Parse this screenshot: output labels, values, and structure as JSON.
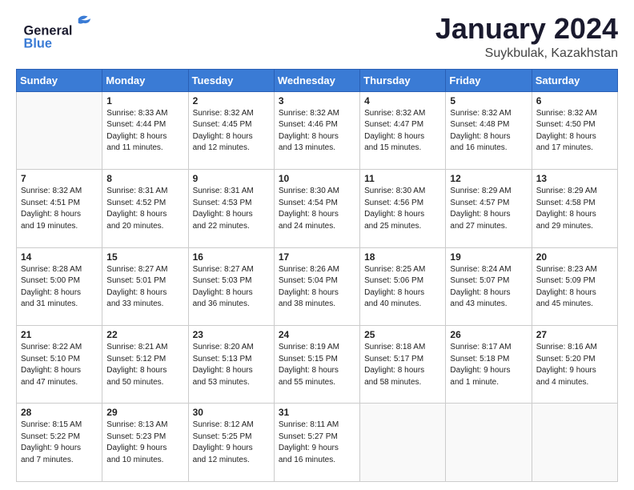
{
  "header": {
    "logo_line1": "General",
    "logo_line2": "Blue",
    "month": "January 2024",
    "location": "Suykbulak, Kazakhstan"
  },
  "days_of_week": [
    "Sunday",
    "Monday",
    "Tuesday",
    "Wednesday",
    "Thursday",
    "Friday",
    "Saturday"
  ],
  "weeks": [
    [
      {
        "day": "",
        "info": ""
      },
      {
        "day": "1",
        "info": "Sunrise: 8:33 AM\nSunset: 4:44 PM\nDaylight: 8 hours\nand 11 minutes."
      },
      {
        "day": "2",
        "info": "Sunrise: 8:32 AM\nSunset: 4:45 PM\nDaylight: 8 hours\nand 12 minutes."
      },
      {
        "day": "3",
        "info": "Sunrise: 8:32 AM\nSunset: 4:46 PM\nDaylight: 8 hours\nand 13 minutes."
      },
      {
        "day": "4",
        "info": "Sunrise: 8:32 AM\nSunset: 4:47 PM\nDaylight: 8 hours\nand 15 minutes."
      },
      {
        "day": "5",
        "info": "Sunrise: 8:32 AM\nSunset: 4:48 PM\nDaylight: 8 hours\nand 16 minutes."
      },
      {
        "day": "6",
        "info": "Sunrise: 8:32 AM\nSunset: 4:50 PM\nDaylight: 8 hours\nand 17 minutes."
      }
    ],
    [
      {
        "day": "7",
        "info": ""
      },
      {
        "day": "8",
        "info": "Sunrise: 8:31 AM\nSunset: 4:52 PM\nDaylight: 8 hours\nand 20 minutes."
      },
      {
        "day": "9",
        "info": "Sunrise: 8:31 AM\nSunset: 4:53 PM\nDaylight: 8 hours\nand 22 minutes."
      },
      {
        "day": "10",
        "info": "Sunrise: 8:30 AM\nSunset: 4:54 PM\nDaylight: 8 hours\nand 24 minutes."
      },
      {
        "day": "11",
        "info": "Sunrise: 8:30 AM\nSunset: 4:56 PM\nDaylight: 8 hours\nand 25 minutes."
      },
      {
        "day": "12",
        "info": "Sunrise: 8:29 AM\nSunset: 4:57 PM\nDaylight: 8 hours\nand 27 minutes."
      },
      {
        "day": "13",
        "info": "Sunrise: 8:29 AM\nSunset: 4:58 PM\nDaylight: 8 hours\nand 29 minutes."
      }
    ],
    [
      {
        "day": "14",
        "info": ""
      },
      {
        "day": "15",
        "info": "Sunrise: 8:27 AM\nSunset: 5:01 PM\nDaylight: 8 hours\nand 33 minutes."
      },
      {
        "day": "16",
        "info": "Sunrise: 8:27 AM\nSunset: 5:03 PM\nDaylight: 8 hours\nand 36 minutes."
      },
      {
        "day": "17",
        "info": "Sunrise: 8:26 AM\nSunset: 5:04 PM\nDaylight: 8 hours\nand 38 minutes."
      },
      {
        "day": "18",
        "info": "Sunrise: 8:25 AM\nSunset: 5:06 PM\nDaylight: 8 hours\nand 40 minutes."
      },
      {
        "day": "19",
        "info": "Sunrise: 8:24 AM\nSunset: 5:07 PM\nDaylight: 8 hours\nand 43 minutes."
      },
      {
        "day": "20",
        "info": "Sunrise: 8:23 AM\nSunset: 5:09 PM\nDaylight: 8 hours\nand 45 minutes."
      }
    ],
    [
      {
        "day": "21",
        "info": ""
      },
      {
        "day": "22",
        "info": "Sunrise: 8:21 AM\nSunset: 5:12 PM\nDaylight: 8 hours\nand 50 minutes."
      },
      {
        "day": "23",
        "info": "Sunrise: 8:20 AM\nSunset: 5:13 PM\nDaylight: 8 hours\nand 53 minutes."
      },
      {
        "day": "24",
        "info": "Sunrise: 8:19 AM\nSunset: 5:15 PM\nDaylight: 8 hours\nand 55 minutes."
      },
      {
        "day": "25",
        "info": "Sunrise: 8:18 AM\nSunset: 5:17 PM\nDaylight: 8 hours\nand 58 minutes."
      },
      {
        "day": "26",
        "info": "Sunrise: 8:17 AM\nSunset: 5:18 PM\nDaylight: 9 hours\nand 1 minute."
      },
      {
        "day": "27",
        "info": "Sunrise: 8:16 AM\nSunset: 5:20 PM\nDaylight: 9 hours\nand 4 minutes."
      }
    ],
    [
      {
        "day": "28",
        "info": "Sunrise: 8:15 AM\nSunset: 5:22 PM\nDaylight: 9 hours\nand 7 minutes."
      },
      {
        "day": "29",
        "info": "Sunrise: 8:13 AM\nSunset: 5:23 PM\nDaylight: 9 hours\nand 10 minutes."
      },
      {
        "day": "30",
        "info": "Sunrise: 8:12 AM\nSunset: 5:25 PM\nDaylight: 9 hours\nand 12 minutes."
      },
      {
        "day": "31",
        "info": "Sunrise: 8:11 AM\nSunset: 5:27 PM\nDaylight: 9 hours\nand 16 minutes."
      },
      {
        "day": "",
        "info": ""
      },
      {
        "day": "",
        "info": ""
      },
      {
        "day": "",
        "info": ""
      }
    ]
  ],
  "week1_sunday_info": "Sunrise: 8:32 AM\nSunset: 4:51 PM\nDaylight: 8 hours\nand 19 minutes.",
  "week2_sunday_info": "Sunrise: 8:28 AM\nSunset: 5:00 PM\nDaylight: 8 hours\nand 31 minutes.",
  "week3_sunday_info": "Sunrise: 8:22 AM\nSunset: 5:10 PM\nDaylight: 8 hours\nand 47 minutes."
}
